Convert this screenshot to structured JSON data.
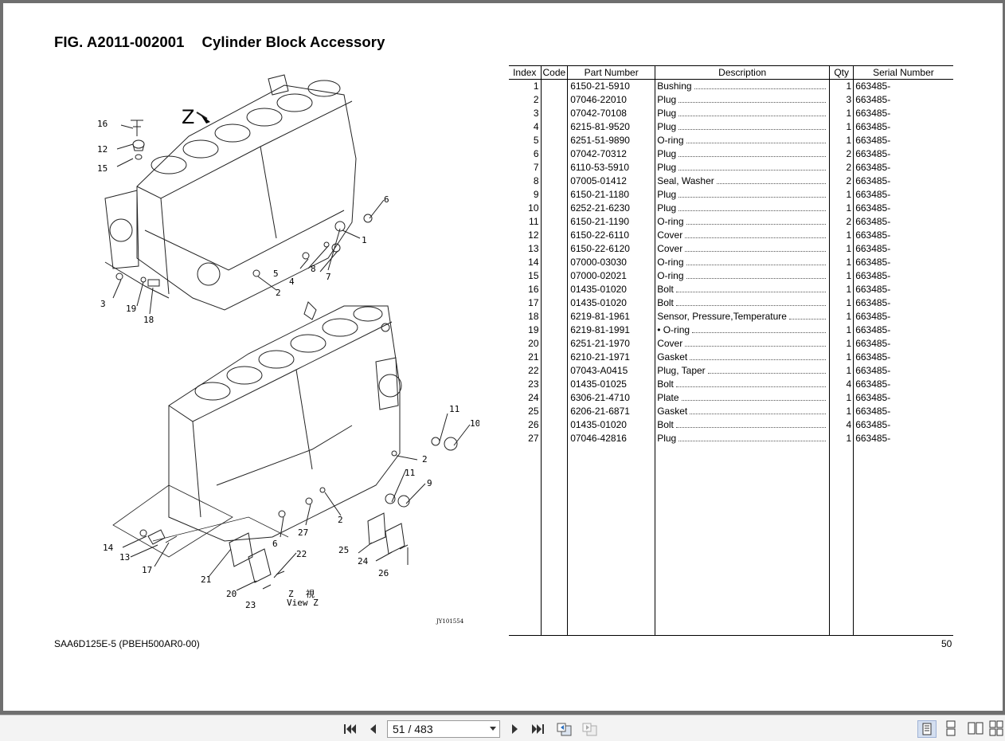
{
  "figure": {
    "number": "FIG. A2011-002001",
    "title": "Cylinder Block Accessory"
  },
  "diagram": {
    "callouts": [
      "16",
      "12",
      "15",
      "6",
      "1",
      "5",
      "8",
      "4",
      "7",
      "2",
      "3",
      "19",
      "18",
      "11",
      "10",
      "2",
      "11",
      "9",
      "2",
      "27",
      "6",
      "14",
      "13",
      "17",
      "25",
      "24",
      "26",
      "21",
      "22",
      "20",
      "23"
    ],
    "view_label_z": "Z",
    "view_label_cjk": "視",
    "view_caption": "View Z",
    "arrow_label": "Z",
    "drawing_id": "JY101554"
  },
  "table": {
    "headers": [
      "Index",
      "Code",
      "Part Number",
      "Description",
      "Qty",
      "Serial Number"
    ],
    "rows": [
      {
        "index": "1",
        "code": "",
        "part": "6150-21-5910",
        "desc": "Bushing",
        "qty": "1",
        "serial": "663485-"
      },
      {
        "index": "2",
        "code": "",
        "part": "07046-22010",
        "desc": "Plug",
        "qty": "3",
        "serial": "663485-"
      },
      {
        "index": "3",
        "code": "",
        "part": "07042-70108",
        "desc": "Plug",
        "qty": "1",
        "serial": "663485-"
      },
      {
        "index": "4",
        "code": "",
        "part": "6215-81-9520",
        "desc": "Plug",
        "qty": "1",
        "serial": "663485-"
      },
      {
        "index": "5",
        "code": "",
        "part": "6251-51-9890",
        "desc": "O-ring",
        "qty": "1",
        "serial": "663485-"
      },
      {
        "index": "6",
        "code": "",
        "part": "07042-70312",
        "desc": "Plug",
        "qty": "2",
        "serial": "663485-"
      },
      {
        "index": "7",
        "code": "",
        "part": "6110-53-5910",
        "desc": "Plug",
        "qty": "2",
        "serial": "663485-"
      },
      {
        "index": "8",
        "code": "",
        "part": "07005-01412",
        "desc": "Seal, Washer",
        "qty": "2",
        "serial": "663485-"
      },
      {
        "index": "9",
        "code": "",
        "part": "6150-21-1180",
        "desc": "Plug",
        "qty": "1",
        "serial": "663485-"
      },
      {
        "index": "10",
        "code": "",
        "part": "6252-21-6230",
        "desc": "Plug",
        "qty": "1",
        "serial": "663485-"
      },
      {
        "index": "11",
        "code": "",
        "part": "6150-21-1190",
        "desc": "O-ring",
        "qty": "2",
        "serial": "663485-"
      },
      {
        "index": "12",
        "code": "",
        "part": "6150-22-6110",
        "desc": "Cover",
        "qty": "1",
        "serial": "663485-"
      },
      {
        "index": "13",
        "code": "",
        "part": "6150-22-6120",
        "desc": "Cover",
        "qty": "1",
        "serial": "663485-"
      },
      {
        "index": "14",
        "code": "",
        "part": "07000-03030",
        "desc": "O-ring",
        "qty": "1",
        "serial": "663485-"
      },
      {
        "index": "15",
        "code": "",
        "part": "07000-02021",
        "desc": "O-ring",
        "qty": "1",
        "serial": "663485-"
      },
      {
        "index": "16",
        "code": "",
        "part": "01435-01020",
        "desc": "Bolt",
        "qty": "1",
        "serial": "663485-"
      },
      {
        "index": "17",
        "code": "",
        "part": "01435-01020",
        "desc": "Bolt",
        "qty": "1",
        "serial": "663485-"
      },
      {
        "index": "18",
        "code": "",
        "part": "6219-81-1961",
        "desc": "Sensor, Pressure,Temperature",
        "qty": "1",
        "serial": "663485-"
      },
      {
        "index": "19",
        "code": "",
        "part": "6219-81-1991",
        "desc": "• O-ring",
        "qty": "1",
        "serial": "663485-"
      },
      {
        "index": "20",
        "code": "",
        "part": "6251-21-1970",
        "desc": "Cover",
        "qty": "1",
        "serial": "663485-"
      },
      {
        "index": "21",
        "code": "",
        "part": "6210-21-1971",
        "desc": "Gasket",
        "qty": "1",
        "serial": "663485-"
      },
      {
        "index": "22",
        "code": "",
        "part": "07043-A0415",
        "desc": "Plug, Taper",
        "qty": "1",
        "serial": "663485-"
      },
      {
        "index": "23",
        "code": "",
        "part": "01435-01025",
        "desc": "Bolt",
        "qty": "4",
        "serial": "663485-"
      },
      {
        "index": "24",
        "code": "",
        "part": "6306-21-4710",
        "desc": "Plate",
        "qty": "1",
        "serial": "663485-"
      },
      {
        "index": "25",
        "code": "",
        "part": "6206-21-6871",
        "desc": "Gasket",
        "qty": "1",
        "serial": "663485-"
      },
      {
        "index": "26",
        "code": "",
        "part": "01435-01020",
        "desc": "Bolt",
        "qty": "4",
        "serial": "663485-"
      },
      {
        "index": "27",
        "code": "",
        "part": "07046-42816",
        "desc": "Plug",
        "qty": "1",
        "serial": "663485-"
      }
    ]
  },
  "footer": {
    "model": "SAA6D125E-5 (PBEH500AR0-00)",
    "page_number": "50"
  },
  "viewer": {
    "page_display": "51 / 483"
  }
}
